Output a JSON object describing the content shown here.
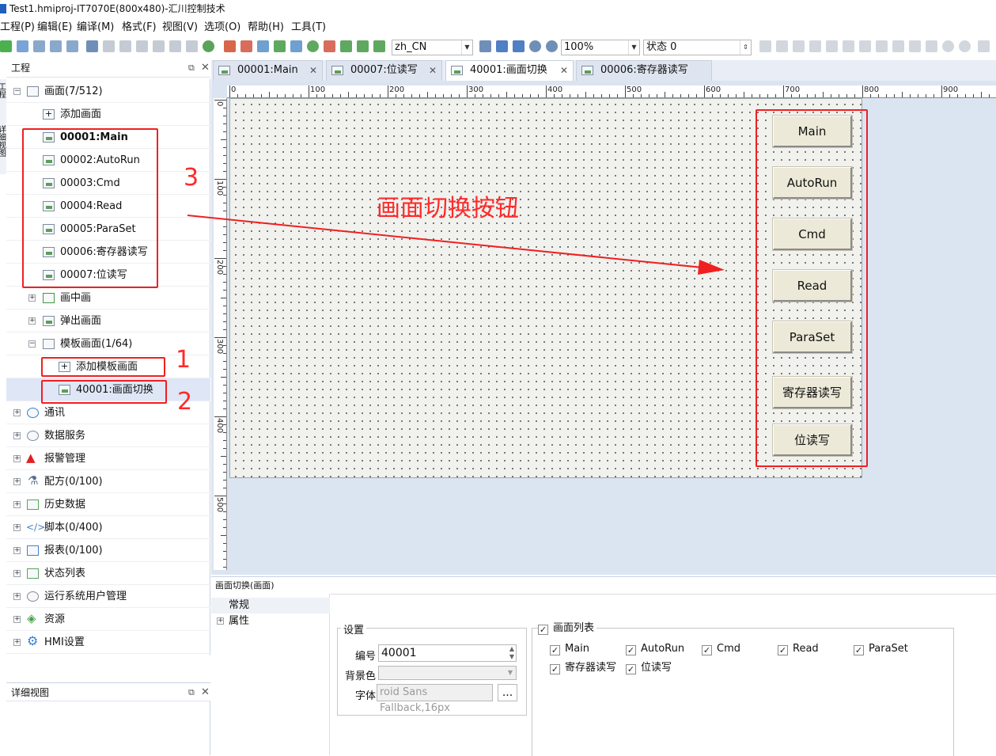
{
  "window": {
    "title": "Test1.hmiproj-IT7070E(800x480)-汇川控制技术"
  },
  "menu": [
    "工程(P)",
    "编辑(E)",
    "编译(M)",
    "格式(F)",
    "视图(V)",
    "选项(O)",
    "帮助(H)",
    "工具(T)"
  ],
  "toolbar": {
    "language": "zh_CN",
    "zoom": "100%",
    "state": "状态 0"
  },
  "left_panel": {
    "title": "工程",
    "tree": [
      {
        "label": "画面(7/512)",
        "icon": "screen-folder-icon"
      },
      {
        "label": "添加画面",
        "icon": "add-screen-icon"
      },
      {
        "label": "00001:Main",
        "icon": "screen-icon"
      },
      {
        "label": "00002:AutoRun",
        "icon": "screen-icon"
      },
      {
        "label": "00003:Cmd",
        "icon": "screen-icon"
      },
      {
        "label": "00004:Read",
        "icon": "screen-icon"
      },
      {
        "label": "00005:ParaSet",
        "icon": "screen-icon"
      },
      {
        "label": "00006:寄存器读写",
        "icon": "screen-icon"
      },
      {
        "label": "00007:位读写",
        "icon": "screen-icon"
      },
      {
        "label": "画中画",
        "icon": "pip-icon"
      },
      {
        "label": "弹出画面",
        "icon": "popup-icon"
      },
      {
        "label": "模板画面(1/64)",
        "icon": "template-icon"
      },
      {
        "label": "添加模板画面",
        "icon": "add-template-icon"
      },
      {
        "label": "40001:画面切换",
        "icon": "screen-icon"
      },
      {
        "label": "通讯",
        "icon": "globe-icon"
      },
      {
        "label": "数据服务",
        "icon": "data-service-icon"
      },
      {
        "label": "报警管理",
        "icon": "alarm-icon"
      },
      {
        "label": "配方(0/100)",
        "icon": "flask-icon"
      },
      {
        "label": "历史数据",
        "icon": "history-icon"
      },
      {
        "label": "脚本(0/400)",
        "icon": "code-icon"
      },
      {
        "label": "报表(0/100)",
        "icon": "report-icon"
      },
      {
        "label": "状态列表",
        "icon": "list-icon"
      },
      {
        "label": "运行系统用户管理",
        "icon": "user-icon"
      },
      {
        "label": "资源",
        "icon": "resource-icon"
      },
      {
        "label": "HMI设置",
        "icon": "gear-icon"
      }
    ],
    "detail_title": "详细视图",
    "side_tabs": [
      "工程",
      "详细视图"
    ]
  },
  "tabs": [
    {
      "label": "00001:Main"
    },
    {
      "label": "00007:位读写"
    },
    {
      "label": "40001:画面切换"
    },
    {
      "label": "00006:寄存器读写"
    }
  ],
  "ruler": {
    "top": [
      "0",
      "100",
      "200",
      "300",
      "400",
      "500",
      "600",
      "700",
      "800",
      "900"
    ],
    "left": [
      "0",
      "100",
      "200",
      "300",
      "400",
      "500"
    ]
  },
  "canvas_buttons": [
    "Main",
    "AutoRun",
    "Cmd",
    "Read",
    "ParaSet",
    "寄存器读写",
    "位读写"
  ],
  "annotations": {
    "arrow_label": "画面切换按钮",
    "n1": "1",
    "n2": "2",
    "n3": "3"
  },
  "properties": {
    "header": "画面切换(画面)",
    "nav": [
      "常规",
      "属性"
    ],
    "settings_title": "设置",
    "id_label": "编号",
    "id_value": "40001",
    "bg_label": "背景色",
    "font_label": "字体",
    "font_value": "roid Sans Fallback,16px",
    "browse": "...",
    "list_title": "画面列表",
    "screens": [
      "Main",
      "AutoRun",
      "Cmd",
      "Read",
      "ParaSet",
      "寄存器读写",
      "位读写"
    ]
  },
  "colors": {
    "accent_red": "#f02020",
    "selection": "#dfe6f6",
    "canvas_bg": "#f1f1ee",
    "workspace": "#dbe4f1"
  }
}
